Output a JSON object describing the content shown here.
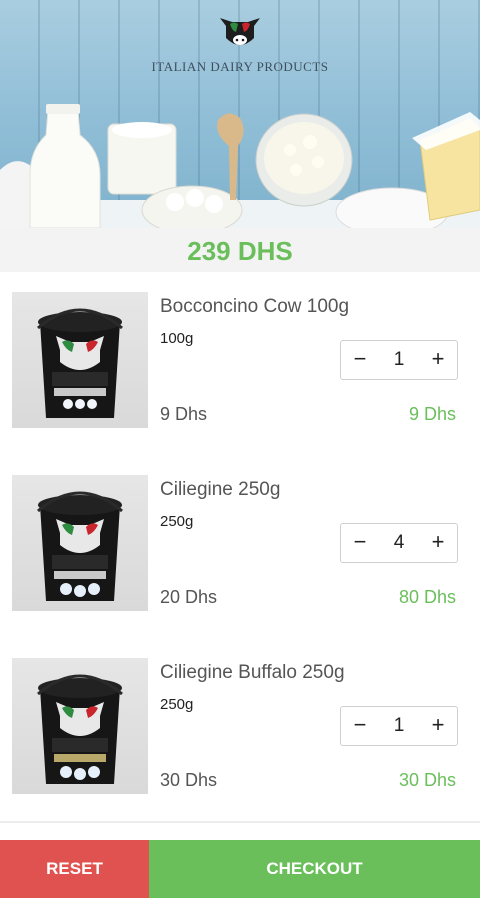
{
  "header": {
    "brand_text": "ITALIAN DAIRY PRODUCTS",
    "logo_icon": "cow-head-logo"
  },
  "cart": {
    "total": "239 DHS"
  },
  "items": [
    {
      "name": "Bocconcino Cow 100g",
      "weight": "100g",
      "quantity": "1",
      "unit_price": "9 Dhs",
      "line_total": "9 Dhs",
      "image_icon": "mozzarella-tub"
    },
    {
      "name": "Ciliegine 250g",
      "weight": "250g",
      "quantity": "4",
      "unit_price": "20 Dhs",
      "line_total": "80 Dhs",
      "image_icon": "mozzarella-tub"
    },
    {
      "name": "Ciliegine Buffalo 250g",
      "weight": "250g",
      "quantity": "1",
      "unit_price": "30 Dhs",
      "line_total": "30 Dhs",
      "image_icon": "mozzarella-tub"
    }
  ],
  "stepper": {
    "minus": "−",
    "plus": "+"
  },
  "footer": {
    "reset_label": "RESET",
    "checkout_label": "CHECKOUT"
  },
  "colors": {
    "accent_green": "#6abf5b",
    "reset_red": "#e0524f"
  }
}
